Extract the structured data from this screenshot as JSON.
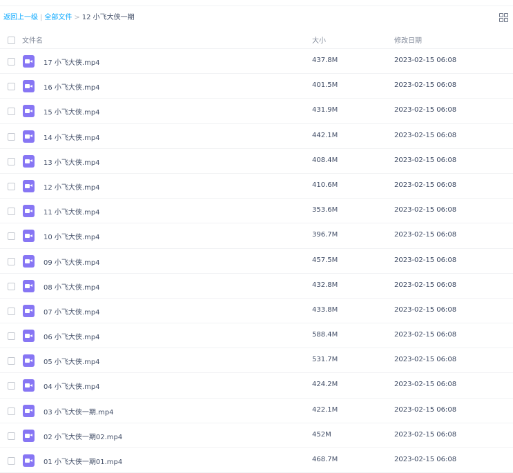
{
  "breadcrumb": {
    "back": "返回上一级",
    "divider": "|",
    "all_files": "全部文件",
    "arrow": ">",
    "current": "12 小飞大侠一期"
  },
  "view_toggle": {
    "icon": "grid-view-icon"
  },
  "columns": {
    "name": "文件名",
    "size": "大小",
    "modified": "修改日期"
  },
  "file_icon": {
    "icon": "video-file-icon",
    "color": "#8776f4"
  },
  "accent_color": "#06a7ff",
  "files": [
    {
      "name": "17 小飞大侠.mp4",
      "size": "437.8M",
      "modified": "2023-02-15 06:08"
    },
    {
      "name": "16 小飞大侠.mp4",
      "size": "401.5M",
      "modified": "2023-02-15 06:08"
    },
    {
      "name": "15 小飞大侠.mp4",
      "size": "431.9M",
      "modified": "2023-02-15 06:08"
    },
    {
      "name": "14 小飞大侠.mp4",
      "size": "442.1M",
      "modified": "2023-02-15 06:08"
    },
    {
      "name": "13 小飞大侠.mp4",
      "size": "408.4M",
      "modified": "2023-02-15 06:08"
    },
    {
      "name": "12 小飞大侠.mp4",
      "size": "410.6M",
      "modified": "2023-02-15 06:08"
    },
    {
      "name": "11 小飞大侠.mp4",
      "size": "353.6M",
      "modified": "2023-02-15 06:08"
    },
    {
      "name": "10 小飞大侠.mp4",
      "size": "396.7M",
      "modified": "2023-02-15 06:08"
    },
    {
      "name": "09 小飞大侠.mp4",
      "size": "457.5M",
      "modified": "2023-02-15 06:08"
    },
    {
      "name": "08 小飞大侠.mp4",
      "size": "432.8M",
      "modified": "2023-02-15 06:08"
    },
    {
      "name": "07 小飞大侠.mp4",
      "size": "433.8M",
      "modified": "2023-02-15 06:08"
    },
    {
      "name": "06 小飞大侠.mp4",
      "size": "588.4M",
      "modified": "2023-02-15 06:08"
    },
    {
      "name": "05 小飞大侠.mp4",
      "size": "531.7M",
      "modified": "2023-02-15 06:08"
    },
    {
      "name": "04 小飞大侠.mp4",
      "size": "424.2M",
      "modified": "2023-02-15 06:08"
    },
    {
      "name": "03 小飞大侠一期.mp4",
      "size": "422.1M",
      "modified": "2023-02-15 06:08"
    },
    {
      "name": "02 小飞大侠一期02.mp4",
      "size": "452M",
      "modified": "2023-02-15 06:08"
    },
    {
      "name": "01 小飞大侠一期01.mp4",
      "size": "468.7M",
      "modified": "2023-02-15 06:08"
    }
  ]
}
